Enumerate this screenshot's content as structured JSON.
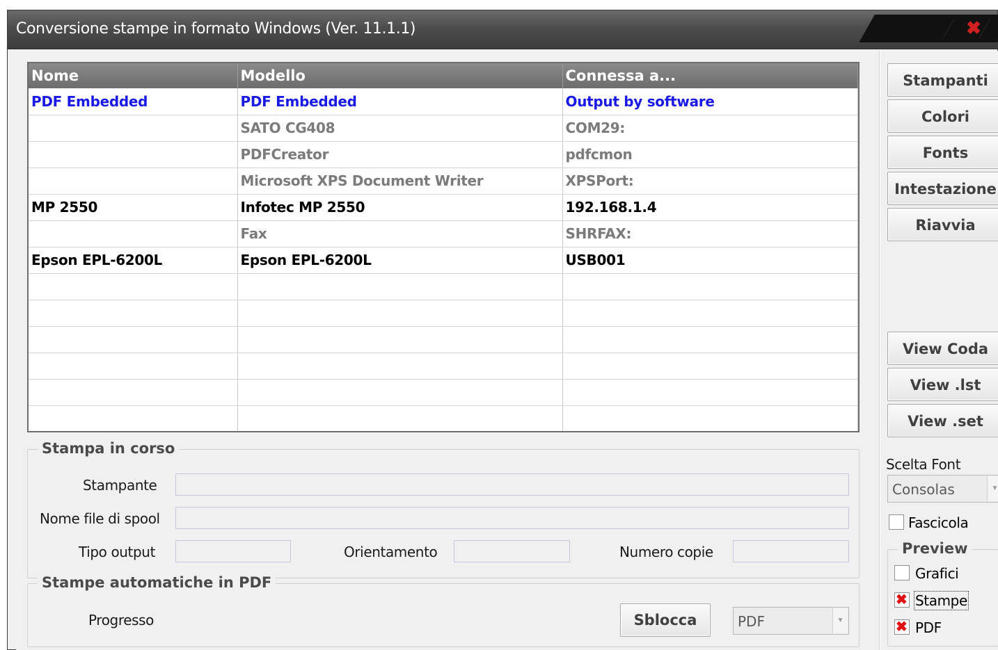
{
  "window": {
    "title": "Conversione stampe in formato Windows (Ver. 11.1.1)",
    "close_glyph": "✖"
  },
  "table": {
    "columns": [
      "Nome",
      "Modello",
      "Connessa a..."
    ],
    "rows": [
      {
        "nome": "PDF Embedded",
        "modello": "PDF Embedded",
        "connessa": "Output by software",
        "style": "blue"
      },
      {
        "nome": "",
        "modello": "SATO CG408",
        "connessa": "COM29:",
        "style": "gray"
      },
      {
        "nome": "",
        "modello": "PDFCreator",
        "connessa": "pdfcmon",
        "style": "gray"
      },
      {
        "nome": "",
        "modello": "Microsoft XPS Document Writer",
        "connessa": "XPSPort:",
        "style": "gray"
      },
      {
        "nome": "MP 2550",
        "modello": "Infotec MP 2550",
        "connessa": "192.168.1.4",
        "style": "black"
      },
      {
        "nome": "",
        "modello": "Fax",
        "connessa": "SHRFAX:",
        "style": "gray"
      },
      {
        "nome": "Epson EPL-6200L",
        "modello": "Epson EPL-6200L",
        "connessa": "USB001",
        "style": "black"
      },
      {
        "nome": "",
        "modello": "",
        "connessa": "",
        "style": "black"
      },
      {
        "nome": "",
        "modello": "",
        "connessa": "",
        "style": "black"
      },
      {
        "nome": "",
        "modello": "",
        "connessa": "",
        "style": "black"
      },
      {
        "nome": "",
        "modello": "",
        "connessa": "",
        "style": "black"
      },
      {
        "nome": "",
        "modello": "",
        "connessa": "",
        "style": "black"
      },
      {
        "nome": "",
        "modello": "",
        "connessa": "",
        "style": "black"
      }
    ]
  },
  "stampa_in_corso": {
    "legend": "Stampa in corso",
    "stampante_label": "Stampante",
    "stampante_value": "",
    "spool_label": "Nome file di spool",
    "spool_value": "",
    "tipo_output_label": "Tipo output",
    "tipo_output_value": "",
    "orientamento_label": "Orientamento",
    "orientamento_value": "",
    "numero_copie_label": "Numero copie",
    "numero_copie_value": ""
  },
  "stampe_automatiche": {
    "legend": "Stampe automatiche in PDF",
    "progresso_label": "Progresso",
    "sblocca_label": "Sblocca",
    "format_value": "PDF"
  },
  "side_buttons": {
    "stampanti": "Stampanti",
    "colori": "Colori",
    "fonts": "Fonts",
    "intestazione": "Intestazione",
    "riavvia": "Riavvia",
    "view_coda": "View Coda",
    "view_lst": "View .lst",
    "view_set": "View .set"
  },
  "font_select": {
    "label": "Scelta Font",
    "value": "Consolas"
  },
  "fascicola": {
    "label": "Fascicola",
    "checked": false
  },
  "preview": {
    "legend": "Preview",
    "grafici": {
      "label": "Grafici",
      "checked": false
    },
    "stampe": {
      "label": "Stampe",
      "checked": true
    },
    "pdf": {
      "label": "PDF",
      "checked": true
    }
  },
  "colors": {
    "blue_text": "#1a1ae6",
    "gray_text": "#7b7b7b",
    "check_mark": "#e01010"
  }
}
